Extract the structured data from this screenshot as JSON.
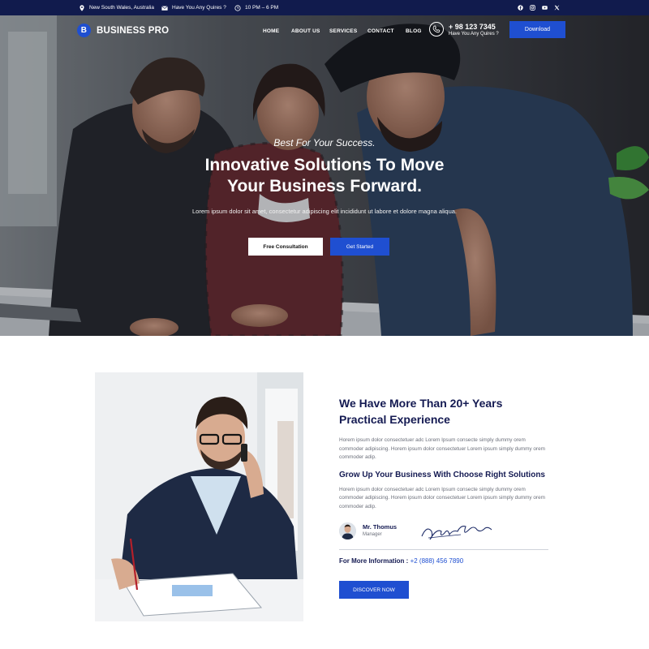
{
  "topbar": {
    "location": "New South Wales, Australia",
    "email": "Have You Any Quires ?",
    "hours": "10 PM – 6 PM",
    "social": [
      "facebook-icon",
      "instagram-icon",
      "youtube-icon",
      "x-icon"
    ]
  },
  "nav": {
    "logo_letter": "B",
    "brand": "BUSINESS PRO",
    "items": [
      "HOME",
      "ABOUT US",
      "SERVICES",
      "CONTACT",
      "BLOG"
    ],
    "phone": "+ 98 123 7345",
    "phone_sub": "Have You Any Quires ?",
    "download": "Download"
  },
  "hero": {
    "tagline": "Best For Your Success.",
    "title_line1": "Innovative Solutions To Move",
    "title_line2": "Your Business Forward.",
    "description": "Lorem ipsum dolor sit amet, consectetur adipiscing elit incididunt ut labore et dolore magna aliqua.",
    "btn_free": "Free Consultation",
    "btn_start": "Get Started"
  },
  "about": {
    "heading_line1": "We Have More Than 20+ Years",
    "heading_line2": "Practical Experience",
    "para1": "Horem ipsum dolor consectetuer adc Lorem Ipsum consecte simply dummy orem commoder adipiscing. Horem ipsum dolor consectetuer Lorem ipsum simply dummy orem commoder adip.",
    "subheading": "Grow Up Your Business With Choose Right Solutions",
    "para2": "Horem ipsum dolor consectetuer adc Lorem Ipsum consecte simply dummy orem commoder adipiscing. Horem ipsum dolor consectetuer Lorem ipsum simply dummy orem commoder adip.",
    "author_name": "Mr. Thomus",
    "author_role": "Manager",
    "more_info_label": "For More Information :",
    "more_info_phone": "+2 (888) 456 7890",
    "discover": "DISCOVER NOW"
  },
  "colors": {
    "brand_blue": "#1f4fd1",
    "navy": "#111b4d",
    "heading": "#141a52"
  }
}
